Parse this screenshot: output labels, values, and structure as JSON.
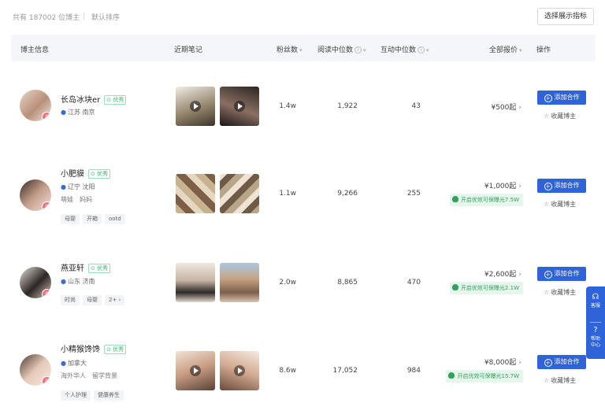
{
  "header": {
    "count": "共有 187002 位博主",
    "sort": "默认排序",
    "choose_button": "选择展示指标"
  },
  "columns": {
    "info": "博主信息",
    "notes": "近期笔记",
    "fans": "粉丝数",
    "read": "阅读中位数",
    "interact": "互动中位数",
    "price": "全部报价",
    "op": "操作"
  },
  "good_label": "优秀",
  "add_label": "添加合作",
  "fav_label": "收藏博主",
  "creators": [
    {
      "name": "长岛冰块er",
      "location": "江苏 南京",
      "categories": [],
      "tags": [],
      "fans": "1.4w",
      "read": "1,922",
      "interact": "43",
      "price": "¥500起",
      "promo": ""
    },
    {
      "name": "小肥貘",
      "location": "辽宁 沈阳",
      "categories": [
        "萌娃",
        "妈妈"
      ],
      "tags": [
        "母婴",
        "开箱",
        "ootd"
      ],
      "fans": "1.1w",
      "read": "9,266",
      "interact": "255",
      "price": "¥1,000起",
      "promo": "开启优效可保曝光7.5W"
    },
    {
      "name": "燕亚轩",
      "location": "山东 济南",
      "categories": [],
      "tags": [
        "时尚",
        "母婴",
        "2+"
      ],
      "fans": "2.0w",
      "read": "8,865",
      "interact": "470",
      "price": "¥2,600起",
      "promo": "开启优效可保曝光2.1W"
    },
    {
      "name": "小精猴馋馋",
      "location": "加拿大",
      "categories": [
        "海外华人",
        "留学背景"
      ],
      "tags": [
        "个人护理",
        "健康养生"
      ],
      "fans": "8.6w",
      "read": "17,052",
      "interact": "984",
      "price": "¥8,000起",
      "promo": "开启优效可保曝光15.7W"
    }
  ],
  "side_float": {
    "service": "客服",
    "help": "帮助中心"
  },
  "icons": [
    "location-pin-icon",
    "shield-check-icon",
    "plus-circle-icon",
    "star-icon",
    "play-icon",
    "headset-icon",
    "question-icon",
    "chevron-right-icon"
  ]
}
